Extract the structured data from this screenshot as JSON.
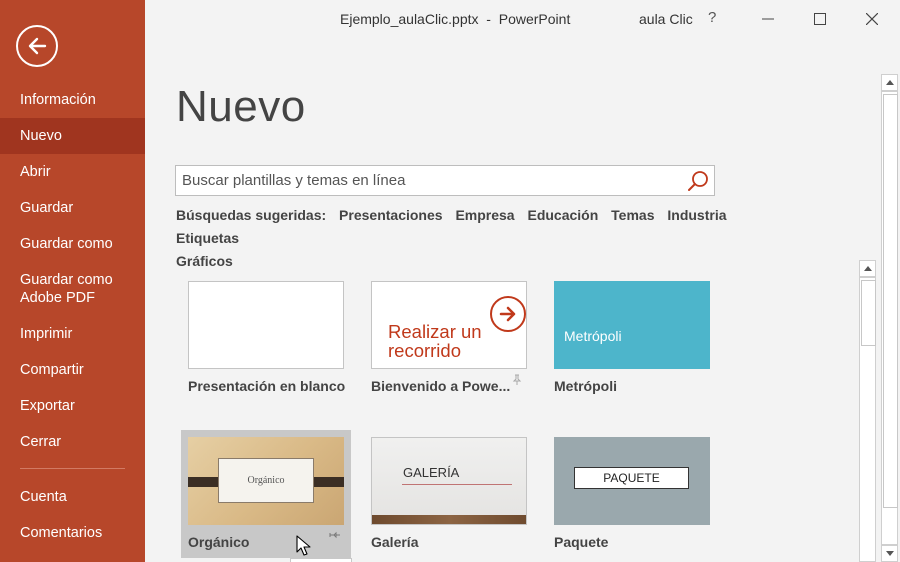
{
  "titlebar": {
    "document": "Ejemplo_aulaClic.pptx  -  PowerPoint",
    "user": "aula Clic",
    "help": "?"
  },
  "sidebar": {
    "items": [
      {
        "label": "Información"
      },
      {
        "label": "Nuevo",
        "active": true
      },
      {
        "label": "Abrir"
      },
      {
        "label": "Guardar"
      },
      {
        "label": "Guardar como"
      },
      {
        "label": "Guardar como Adobe PDF"
      },
      {
        "label": "Imprimir"
      },
      {
        "label": "Compartir"
      },
      {
        "label": "Exportar"
      },
      {
        "label": "Cerrar"
      }
    ],
    "footer_items": [
      {
        "label": "Cuenta"
      },
      {
        "label": "Comentarios"
      }
    ],
    "accent_color": "#b7472a",
    "active_color": "#a0351f"
  },
  "main": {
    "title": "Nuevo",
    "search": {
      "placeholder": "Buscar plantillas y temas en línea",
      "value": ""
    },
    "suggested": {
      "label": "Búsquedas sugeridas:",
      "links": [
        "Presentaciones",
        "Empresa",
        "Educación",
        "Temas",
        "Industria",
        "Etiquetas",
        "Gráficos"
      ]
    },
    "templates": [
      {
        "name": "Presentación en blanco"
      },
      {
        "name": "Bienvenido a Powe...",
        "thumb_text_1": "Realizar un",
        "thumb_text_2": "recorrido",
        "pinnable": true
      },
      {
        "name": "Metrópoli",
        "thumb_text": "Metrópoli",
        "thumb_color": "#4db5cb"
      },
      {
        "name": "Orgánico",
        "thumb_text": "Orgánico",
        "selected": true,
        "pinnable": true
      },
      {
        "name": "Galería",
        "thumb_text": "GALERÍA"
      },
      {
        "name": "Paquete",
        "thumb_text": "PAQUETE"
      }
    ]
  }
}
